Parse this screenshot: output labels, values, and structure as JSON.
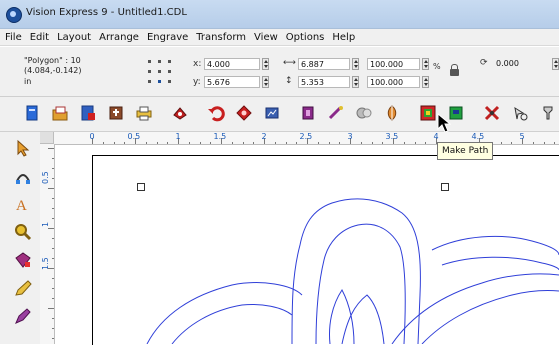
{
  "window": {
    "title": "Vision Express 9 - Untitled1.CDL"
  },
  "menu": [
    "File",
    "Edit",
    "Layout",
    "Arrange",
    "Engrave",
    "Transform",
    "View",
    "Options",
    "Help"
  ],
  "properties": {
    "object_name": "\"Polygon\" : 10",
    "cursor_pos": "(4.084,-0.142)",
    "unit": "in",
    "x_label": "x:",
    "x_value": "4.000",
    "y_label": "y:",
    "y_value": "5.676",
    "width_value": "6.887",
    "height_value": "5.353",
    "scale_x": "100.000",
    "scale_y": "100.000",
    "percent": "%",
    "rotation": "0.000"
  },
  "tooltip": "Make Path",
  "ruler": {
    "h_labels": [
      "0",
      "0.5",
      "1",
      "1.5",
      "2",
      "2.5",
      "3",
      "3.5",
      "4",
      "4.5",
      "5"
    ],
    "v_labels": [
      "0.5",
      "1",
      "1.5"
    ]
  },
  "colors": {
    "outline": "#2f3fd8",
    "titlebar": "#c8dbf1",
    "ruler_text": "#1b5bb8"
  },
  "icons": {
    "toolbar": [
      "new-file-icon",
      "open-file-icon",
      "save-file-icon",
      "import-icon",
      "print-icon",
      "plot-icon",
      "undo-icon",
      "redo-icon",
      "view-icon",
      "fill-icon",
      "node-edit-icon",
      "weld-icon",
      "mirror-icon",
      "make-path-icon",
      "output-icon",
      "break-apart-icon",
      "transform-icon"
    ],
    "toolbox": [
      "select-tool-icon",
      "node-tool-icon",
      "text-tool-icon",
      "zoom-tool-icon",
      "color-tool-icon",
      "pencil-tool-icon",
      "pen-tool-icon"
    ]
  }
}
